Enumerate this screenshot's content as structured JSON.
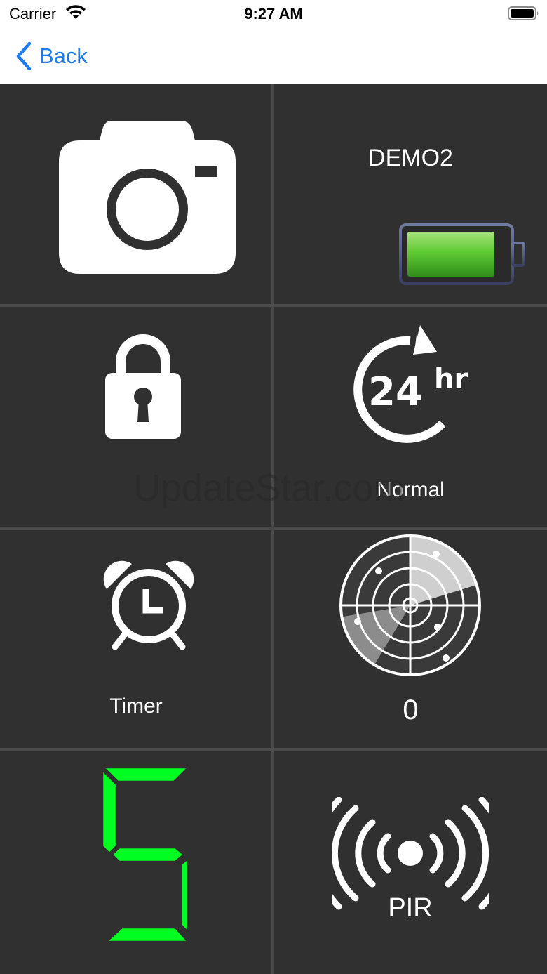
{
  "status_bar": {
    "carrier": "Carrier",
    "time": "9:27 AM",
    "icons": [
      "wifi-icon",
      "battery-icon"
    ]
  },
  "nav": {
    "back_label": "Back",
    "back_icon": "chevron-left-icon",
    "accent_color": "#1e7cf0"
  },
  "tiles": {
    "camera": {
      "icon": "camera-icon"
    },
    "device": {
      "name": "DEMO2",
      "battery_icon": "battery-full-icon",
      "battery_color": "#4fc12d"
    },
    "lock": {
      "icon": "lock-icon"
    },
    "mode": {
      "icon": "24hr-icon",
      "icon_text": "24",
      "icon_suffix": "hr",
      "label": "Normal"
    },
    "timer": {
      "icon": "alarm-clock-icon",
      "label": "Timer"
    },
    "radar": {
      "icon": "radar-icon",
      "value": "0"
    },
    "digit": {
      "icon": "seven-segment-digit-icon",
      "value": "5",
      "color": "#00ff20"
    },
    "pir": {
      "icon": "pir-sensor-icon",
      "label": "PIR"
    }
  },
  "watermark": "UpdateStar.com",
  "colors": {
    "tile_bg": "#303030",
    "grid_line": "#4a4a4a"
  }
}
